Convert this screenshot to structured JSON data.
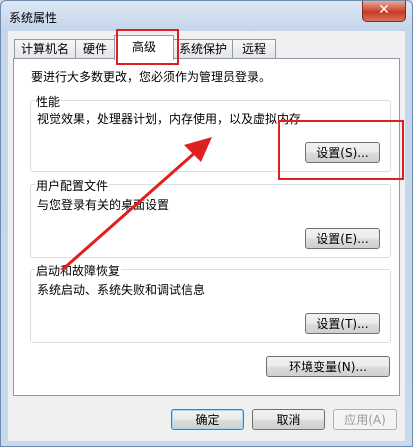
{
  "window": {
    "title": "系统属性"
  },
  "tabs": [
    {
      "label": "计算机名",
      "active": false
    },
    {
      "label": "硬件",
      "active": false
    },
    {
      "label": "高级",
      "active": true
    },
    {
      "label": "系统保护",
      "active": false
    },
    {
      "label": "远程",
      "active": false
    }
  ],
  "advanced": {
    "admin_notice": "要进行大多数更改，您必须作为管理员登录。",
    "performance": {
      "title": "性能",
      "description": "视觉效果，处理器计划，内存使用，以及虚拟内存",
      "button": "设置(S)..."
    },
    "user_profiles": {
      "title": "用户配置文件",
      "description": "与您登录有关的桌面设置",
      "button": "设置(E)..."
    },
    "startup_recovery": {
      "title": "启动和故障恢复",
      "description": "系统启动、系统失败和调试信息",
      "button": "设置(T)..."
    },
    "env_vars_button": "环境变量(N)..."
  },
  "footer": {
    "ok": "确定",
    "cancel": "取消",
    "apply": "应用(A)"
  },
  "annotation": {
    "color": "#e02020"
  }
}
